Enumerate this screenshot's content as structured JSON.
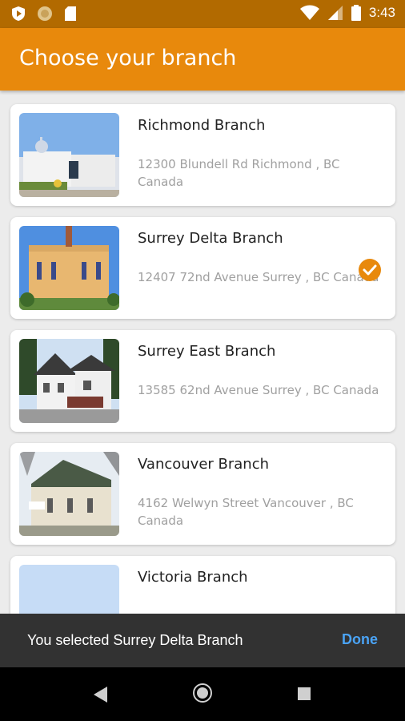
{
  "status_bar": {
    "time": "3:43",
    "left_icons": [
      "shield-icon",
      "circle-icon",
      "sd-card-icon"
    ],
    "right_icons": [
      "wifi-icon",
      "signal-icon",
      "battery-icon"
    ]
  },
  "app_bar": {
    "title": "Choose your branch",
    "color": "#e8890c"
  },
  "branches": [
    {
      "name": "Richmond Branch",
      "address": "12300 Blundell Rd Richmond , BC Canada",
      "selected": false
    },
    {
      "name": "Surrey Delta Branch",
      "address": "12407 72nd Avenue Surrey , BC Canada",
      "selected": true
    },
    {
      "name": "Surrey East Branch",
      "address": "13585 62nd Avenue Surrey , BC Canada",
      "selected": false
    },
    {
      "name": "Vancouver Branch",
      "address": "4162 Welwyn Street Vancouver , BC Canada",
      "selected": false
    },
    {
      "name": "Victoria Branch",
      "address": "",
      "selected": false
    }
  ],
  "snackbar": {
    "message": "You selected Surrey Delta Branch",
    "action": "Done",
    "action_color": "#4aa3f5"
  },
  "nav_bar": {
    "icons": [
      "back-icon",
      "home-icon",
      "recents-icon"
    ]
  }
}
